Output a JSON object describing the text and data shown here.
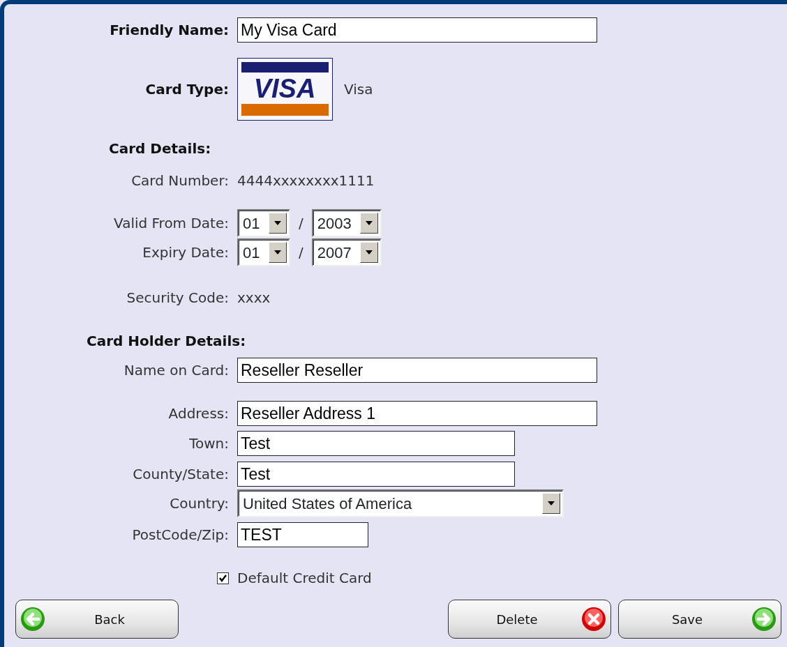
{
  "friendly_name": {
    "label": "Friendly Name:",
    "value": "My Visa Card"
  },
  "card_type": {
    "label": "Card Type:",
    "logo_text": "VISA",
    "name": "Visa"
  },
  "card_details": {
    "heading": "Card Details:",
    "card_number": {
      "label": "Card Number:",
      "value": "4444xxxxxxxx1111"
    },
    "valid_from": {
      "label": "Valid From Date:",
      "month": "01",
      "separator": "/",
      "year": "2003"
    },
    "expiry": {
      "label": "Expiry Date:",
      "month": "01",
      "separator": "/",
      "year": "2007"
    },
    "security_code": {
      "label": "Security Code:",
      "value": "xxxx"
    }
  },
  "card_holder": {
    "heading": "Card Holder Details:",
    "fields": [
      {
        "label": "Name on Card:",
        "value": "Reseller Reseller",
        "kind": "text"
      },
      {
        "label": "Address:",
        "value": "Reseller Address 1",
        "kind": "text"
      },
      {
        "label": "Town:",
        "value": "Test",
        "kind": "text"
      },
      {
        "label": "County/State:",
        "value": "Test",
        "kind": "text"
      },
      {
        "label": "Country:",
        "value": "United States of America",
        "kind": "select"
      },
      {
        "label": "PostCode/Zip:",
        "value": "TEST",
        "kind": "text"
      }
    ]
  },
  "default_card": {
    "label": "Default Credit Card",
    "checked": true
  },
  "buttons": [
    {
      "label": "Back",
      "kind": "back"
    },
    {
      "label": "Delete",
      "kind": "delete"
    },
    {
      "label": "Save",
      "kind": "save"
    }
  ]
}
